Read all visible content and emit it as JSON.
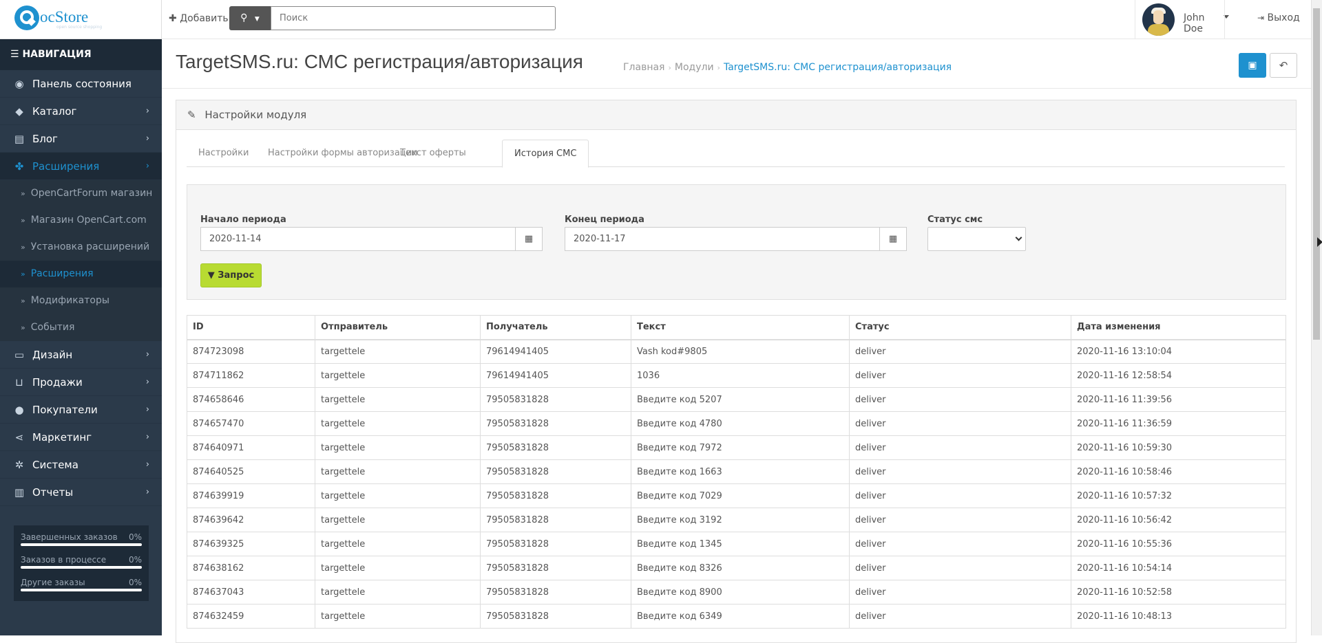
{
  "header": {
    "logo_text": "ocStore",
    "logo_subtitle": "open source shopping",
    "add_label": "Добавить",
    "search_placeholder": "Поиск",
    "user_name": "John Doe",
    "logout_label": "Выход"
  },
  "sidebar": {
    "nav_title": "НАВИГАЦИЯ",
    "items": [
      {
        "label": "Панель состояния",
        "icon": "dashboard-icon"
      },
      {
        "label": "Каталог",
        "icon": "tags-icon"
      },
      {
        "label": "Блог",
        "icon": "book-icon"
      },
      {
        "label": "Расширения",
        "icon": "puzzle-icon"
      },
      {
        "label": "Дизайн",
        "icon": "desktop-icon"
      },
      {
        "label": "Продажи",
        "icon": "cart-icon"
      },
      {
        "label": "Покупатели",
        "icon": "user-icon"
      },
      {
        "label": "Маркетинг",
        "icon": "share-icon"
      },
      {
        "label": "Система",
        "icon": "cog-icon"
      },
      {
        "label": "Отчеты",
        "icon": "bar-chart-icon"
      }
    ],
    "extensions_sub": [
      {
        "label": "OpenCartForum магазин"
      },
      {
        "label": "Магазин OpenCart.com"
      },
      {
        "label": "Установка расширений"
      },
      {
        "label": "Расширения"
      },
      {
        "label": "Модификаторы"
      },
      {
        "label": "События"
      }
    ],
    "stats": [
      {
        "label": "Завершенных заказов",
        "value": "0%"
      },
      {
        "label": "Заказов в процессе",
        "value": "0%"
      },
      {
        "label": "Другие заказы",
        "value": "0%"
      }
    ]
  },
  "page": {
    "title": "TargetSMS.ru: СМС регистрация/авторизация",
    "breadcrumbs": [
      "Главная",
      "Модули",
      "TargetSMS.ru: СМС регистрация/авторизация"
    ],
    "panel_title": "Настройки модуля",
    "tabs": [
      "Настройки",
      "Настройки формы авторизации",
      "Текст оферты",
      "История СМС"
    ],
    "active_tab": "История СМС"
  },
  "filter": {
    "start_label": "Начало периода",
    "start_value": "2020-11-14",
    "end_label": "Конец периода",
    "end_value": "2020-11-17",
    "status_label": "Статус смс",
    "status_value": "",
    "query_button": "Запрос"
  },
  "table": {
    "columns": [
      "ID",
      "Отправитель",
      "Получатель",
      "Текст",
      "Статус",
      "Дата изменения"
    ],
    "rows": [
      [
        "874723098",
        "targettele",
        "79614941405",
        "Vash kod#9805",
        "deliver",
        "2020-11-16 13:10:04"
      ],
      [
        "874711862",
        "targettele",
        "79614941405",
        "1036",
        "deliver",
        "2020-11-16 12:58:54"
      ],
      [
        "874658646",
        "targettele",
        "79505831828",
        "Введите код 5207",
        "deliver",
        "2020-11-16 11:39:56"
      ],
      [
        "874657470",
        "targettele",
        "79505831828",
        "Введите код 4780",
        "deliver",
        "2020-11-16 11:36:59"
      ],
      [
        "874640971",
        "targettele",
        "79505831828",
        "Введите код 7972",
        "deliver",
        "2020-11-16 10:59:30"
      ],
      [
        "874640525",
        "targettele",
        "79505831828",
        "Введите код 1663",
        "deliver",
        "2020-11-16 10:58:46"
      ],
      [
        "874639919",
        "targettele",
        "79505831828",
        "Введите код 7029",
        "deliver",
        "2020-11-16 10:57:32"
      ],
      [
        "874639642",
        "targettele",
        "79505831828",
        "Введите код 3192",
        "deliver",
        "2020-11-16 10:56:42"
      ],
      [
        "874639325",
        "targettele",
        "79505831828",
        "Введите код 1345",
        "deliver",
        "2020-11-16 10:55:36"
      ],
      [
        "874638162",
        "targettele",
        "79505831828",
        "Введите код 8326",
        "deliver",
        "2020-11-16 10:54:14"
      ],
      [
        "874637043",
        "targettele",
        "79505831828",
        "Введите код 8900",
        "deliver",
        "2020-11-16 10:52:58"
      ],
      [
        "874632459",
        "targettele",
        "79505831828",
        "Введите код 6349",
        "deliver",
        "2020-11-16 10:48:13"
      ]
    ]
  },
  "colors": {
    "accent": "#1e91cf",
    "sidebar_bg": "#2b3a4a",
    "query_button": "#b8db32"
  }
}
